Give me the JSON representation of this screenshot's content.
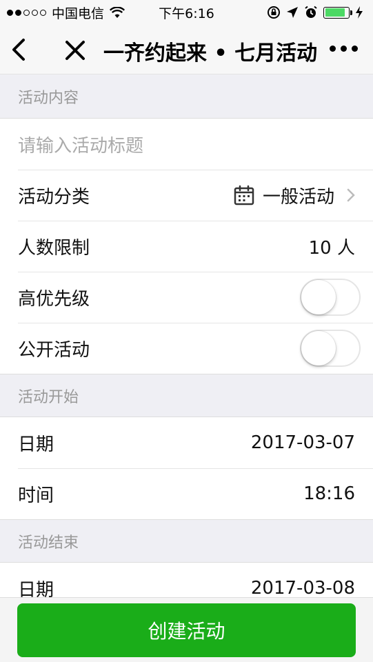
{
  "status_bar": {
    "carrier": "中国电信",
    "time": "下午6:16",
    "battery_level": 0.85
  },
  "nav": {
    "title": "一齐约起来 • 七月活动"
  },
  "sections": {
    "content": {
      "header": "活动内容",
      "title_placeholder": "请输入活动标题",
      "category_label": "活动分类",
      "category_value": "一般活动",
      "limit_label": "人数限制",
      "limit_value": "10 人",
      "priority_label": "高优先级",
      "priority_on": false,
      "public_label": "公开活动",
      "public_on": false
    },
    "start": {
      "header": "活动开始",
      "date_label": "日期",
      "date_value": "2017-03-07",
      "time_label": "时间",
      "time_value": "18:16"
    },
    "end": {
      "header": "活动结束",
      "date_label": "日期",
      "date_value": "2017-03-08"
    }
  },
  "footer": {
    "create_label": "创建活动"
  },
  "colors": {
    "accent": "#1aad19",
    "battery": "#4cd964",
    "background": "#efeff4"
  },
  "icons": {
    "back": "chevron-left-icon",
    "close": "close-icon",
    "more": "more-dots-icon",
    "category": "calendar-icon"
  }
}
